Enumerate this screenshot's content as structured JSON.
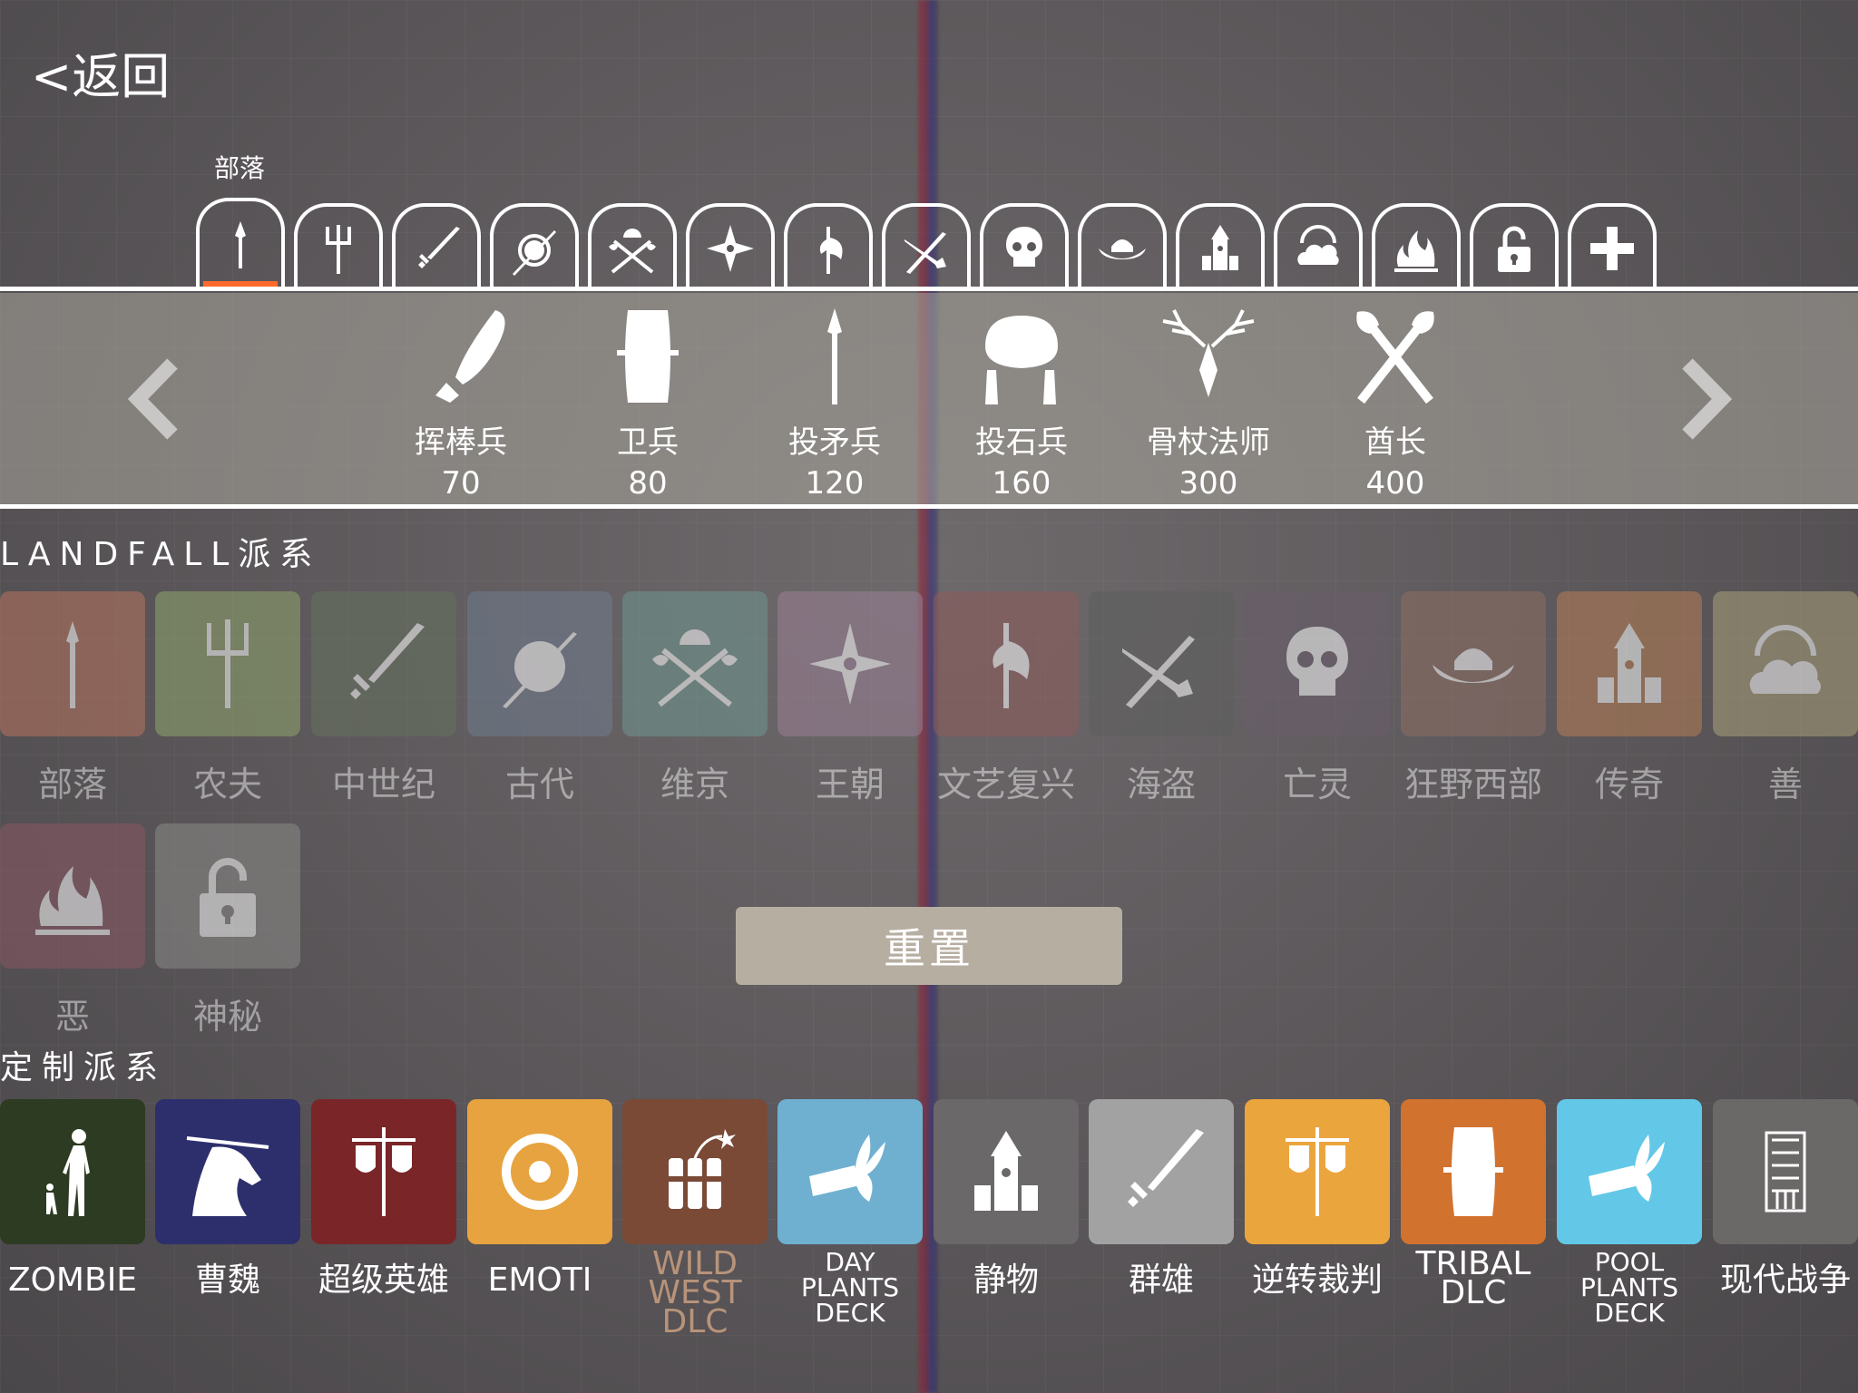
{
  "nav": {
    "back_label": "<返回"
  },
  "faction_tabs": {
    "selected_label": "部落",
    "tabs": [
      {
        "icon": "spear-icon"
      },
      {
        "icon": "trident-icon"
      },
      {
        "icon": "sword-icon"
      },
      {
        "icon": "shield-spear-icon"
      },
      {
        "icon": "crossed-axes-helmet-icon"
      },
      {
        "icon": "shuriken-icon"
      },
      {
        "icon": "halberd-icon"
      },
      {
        "icon": "crossed-sword-pistol-icon"
      },
      {
        "icon": "skull-icon"
      },
      {
        "icon": "cowboy-hat-icon"
      },
      {
        "icon": "castle-icon"
      },
      {
        "icon": "cloud-halo-icon"
      },
      {
        "icon": "flames-icon"
      },
      {
        "icon": "padlock-icon"
      },
      {
        "icon": "plus-icon"
      }
    ]
  },
  "units": [
    {
      "name": "挥棒兵",
      "cost": "70",
      "icon": "club-icon"
    },
    {
      "name": "卫兵",
      "cost": "80",
      "icon": "wooden-shield-icon"
    },
    {
      "name": "投矛兵",
      "cost": "120",
      "icon": "spear-icon"
    },
    {
      "name": "投石兵",
      "cost": "160",
      "icon": "boulder-icon"
    },
    {
      "name": "骨杖法师",
      "cost": "300",
      "icon": "antler-staff-icon"
    },
    {
      "name": "酋长",
      "cost": "400",
      "icon": "crossed-axes-icon"
    }
  ],
  "landfall": {
    "title": "LANDFALL派系",
    "factions": [
      {
        "label": "部落",
        "color": "#b8735e"
      },
      {
        "label": "农夫",
        "color": "#8fa46b"
      },
      {
        "label": "中世纪",
        "color": "#66725f"
      },
      {
        "label": "古代",
        "color": "#6f7c8e"
      },
      {
        "label": "维京",
        "color": "#6f9690"
      },
      {
        "label": "王朝",
        "color": "#9a7f94"
      },
      {
        "label": "文艺复兴",
        "color": "#8f5b5b"
      },
      {
        "label": "海盗",
        "color": "#5e5f5d"
      },
      {
        "label": "亡灵",
        "color": "#6a5d6c"
      },
      {
        "label": "狂野西部",
        "color": "#8e6e62"
      },
      {
        "label": "传奇",
        "color": "#b87e55"
      },
      {
        "label": "善",
        "color": "#a9a07a"
      },
      {
        "label": "恶",
        "color": "#8a5763"
      },
      {
        "label": "神秘",
        "color": "#8c8a88"
      }
    ]
  },
  "reset_label": "重置",
  "custom": {
    "title": "定制派系",
    "factions": [
      {
        "label": "ZOMBIE",
        "color": "#2c3b21"
      },
      {
        "label": "曹魏",
        "color": "#2d2f6c"
      },
      {
        "label": "超级英雄",
        "color": "#7a2628"
      },
      {
        "label": "EMOTI",
        "color": "#e7a33f"
      },
      {
        "label": "WILD WEST DLC",
        "color": "#7a4a37",
        "label_color": "#b8937a"
      },
      {
        "label": "DAY PLANTS DECK",
        "color": "#6fb0d0"
      },
      {
        "label": "静物",
        "color": "#6a6868"
      },
      {
        "label": "群雄",
        "color": "#a3a2a2"
      },
      {
        "label": "逆转裁判",
        "color": "#eba53d"
      },
      {
        "label": "TRIBAL DLC",
        "color": "#d2722f"
      },
      {
        "label": "POOL PLANTS DECK",
        "color": "#63c8e8"
      },
      {
        "label": "现代战争",
        "color": "#6b6868"
      }
    ]
  }
}
